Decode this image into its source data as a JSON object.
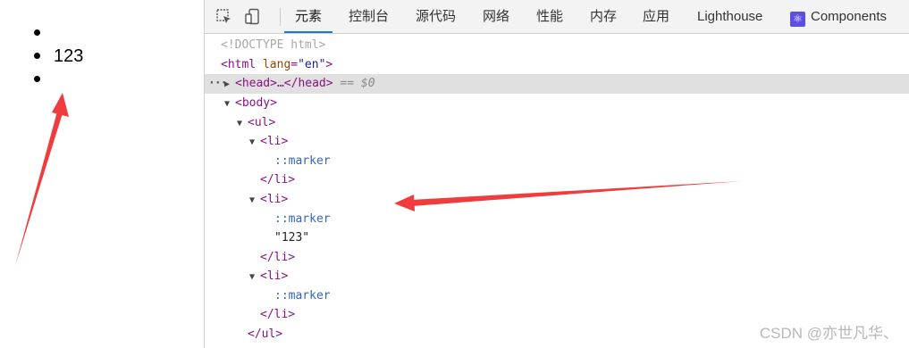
{
  "page": {
    "list_items": [
      "",
      "123",
      ""
    ]
  },
  "devtools": {
    "icons": [
      "inspect-element-icon",
      "device-toolbar-icon"
    ],
    "tabs": [
      {
        "label": "元素",
        "active": true
      },
      {
        "label": "控制台"
      },
      {
        "label": "源代码"
      },
      {
        "label": "网络"
      },
      {
        "label": "性能"
      },
      {
        "label": "内存"
      },
      {
        "label": "应用"
      },
      {
        "label": "Lighthouse"
      },
      {
        "label": "Components"
      }
    ],
    "dom": {
      "doctype": "<!DOCTYPE html>",
      "html_tag": "html",
      "html_attr": "lang",
      "html_attr_val": "\"en\"",
      "head": "<head>…</head>",
      "selected_marker": "== $0",
      "body": "<body>",
      "ul_open": "<ul>",
      "li_open": "<li>",
      "marker": "::marker",
      "li_close": "</li>",
      "text_node": "\"123\"",
      "ul_close": "</ul>"
    }
  },
  "colors": {
    "arrow": "#f03c3c",
    "tab_underline": "#1a73e8"
  },
  "watermark": "CSDN @亦世凡华、"
}
